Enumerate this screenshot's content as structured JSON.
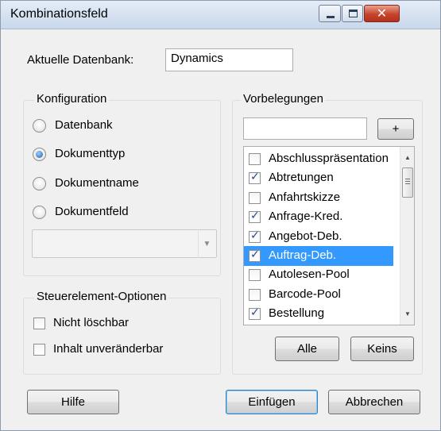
{
  "window": {
    "title": "Kombinationsfeld",
    "close_glyph": "✕"
  },
  "database": {
    "label": "Aktuelle Datenbank:",
    "value": "Dynamics"
  },
  "konfiguration": {
    "title": "Konfiguration",
    "options": [
      {
        "label": "Datenbank",
        "checked": false
      },
      {
        "label": "Dokumenttyp",
        "checked": true
      },
      {
        "label": "Dokumentname",
        "checked": false
      },
      {
        "label": "Dokumentfeld",
        "checked": false
      }
    ],
    "combo_value": ""
  },
  "steuerelement": {
    "title": "Steuerelement-Optionen",
    "options": [
      {
        "label": "Nicht löschbar",
        "checked": false
      },
      {
        "label": "Inhalt unveränderbar",
        "checked": false
      }
    ]
  },
  "vorbelegungen": {
    "title": "Vorbelegungen",
    "input_value": "",
    "add_label": "+",
    "items": [
      {
        "label": "Abschlusspräsentation",
        "checked": false,
        "selected": false
      },
      {
        "label": "Abtretungen",
        "checked": true,
        "selected": false
      },
      {
        "label": "Anfahrtskizze",
        "checked": false,
        "selected": false
      },
      {
        "label": "Anfrage-Kred.",
        "checked": true,
        "selected": false
      },
      {
        "label": "Angebot-Deb.",
        "checked": true,
        "selected": false
      },
      {
        "label": "Auftrag-Deb.",
        "checked": true,
        "selected": true
      },
      {
        "label": "Autolesen-Pool",
        "checked": false,
        "selected": false
      },
      {
        "label": "Barcode-Pool",
        "checked": false,
        "selected": false
      },
      {
        "label": "Bestellung",
        "checked": true,
        "selected": false
      }
    ],
    "all_label": "Alle",
    "none_label": "Keins"
  },
  "footer": {
    "help_label": "Hilfe",
    "insert_label": "Einfügen",
    "cancel_label": "Abbrechen"
  },
  "colors": {
    "selection": "#3399ff",
    "dialog_bg": "#f0f0f0",
    "close_button": "#c7442c"
  }
}
